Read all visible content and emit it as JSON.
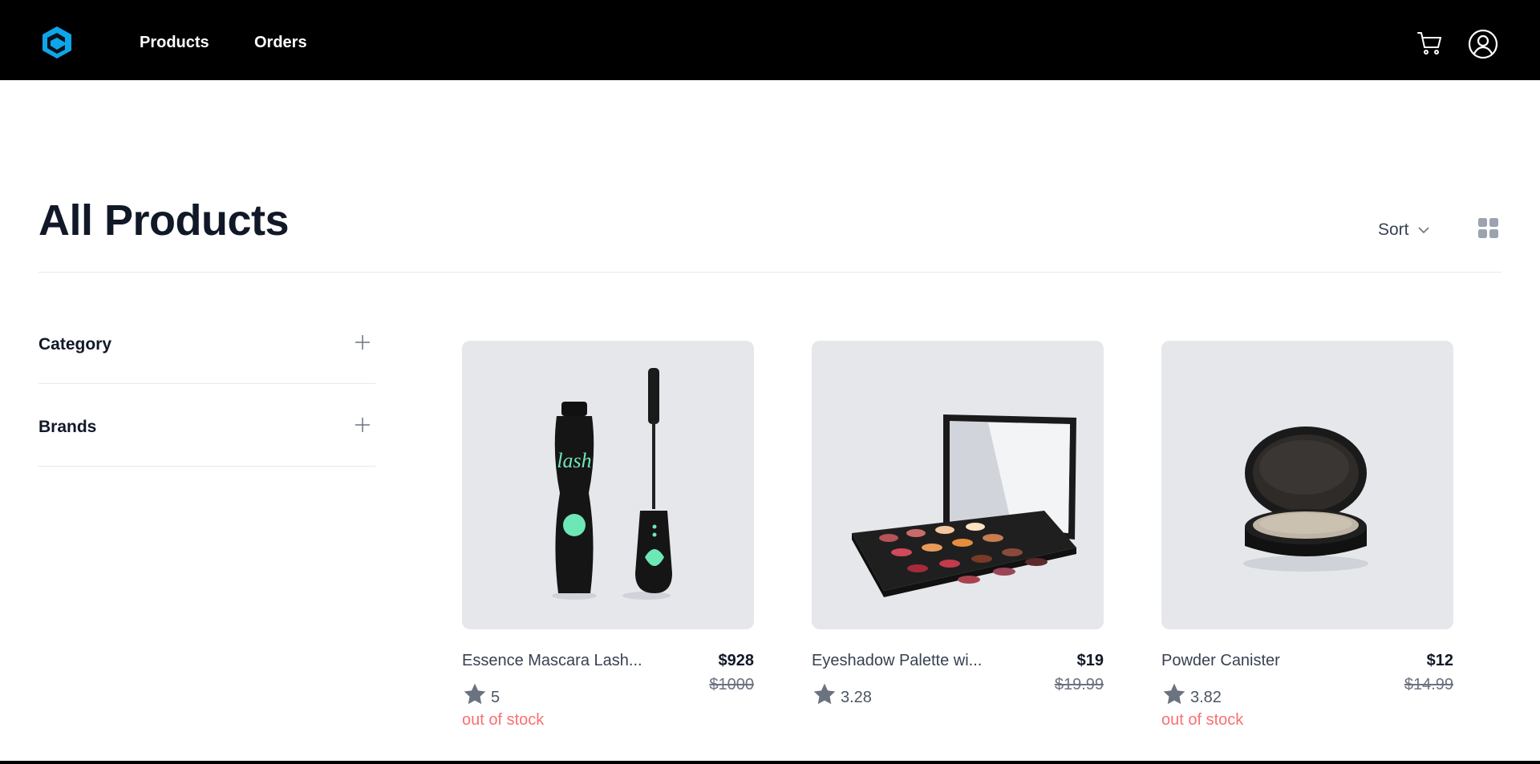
{
  "navbar": {
    "logo_icon": "brand-logo-icon",
    "links": [
      "Products",
      "Orders"
    ],
    "cart_icon": "cart-icon",
    "user_icon": "user-circle-icon"
  },
  "header": {
    "title": "All Products",
    "sort_label": "Sort",
    "sort_icon": "chevron-down-icon",
    "view_icon": "grid-view-icon"
  },
  "filters": [
    {
      "label": "Category",
      "icon": "plus-icon"
    },
    {
      "label": "Brands",
      "icon": "plus-icon"
    }
  ],
  "products": [
    {
      "name": "Essence Mascara Lash...",
      "price": "$928",
      "old_price": "$1000",
      "rating": "5",
      "stock": "out of stock"
    },
    {
      "name": "Eyeshadow Palette wi...",
      "price": "$19",
      "old_price": "$19.99",
      "rating": "3.28",
      "stock": ""
    },
    {
      "name": "Powder Canister",
      "price": "$12",
      "old_price": "$14.99",
      "rating": "3.82",
      "stock": "out of stock"
    }
  ],
  "colors": {
    "navbar_bg": "#000000",
    "logo_blue": "#0ea5e9",
    "image_bg": "#e5e7eb",
    "stock_red": "#f87171",
    "star_gray": "#6b7280"
  }
}
